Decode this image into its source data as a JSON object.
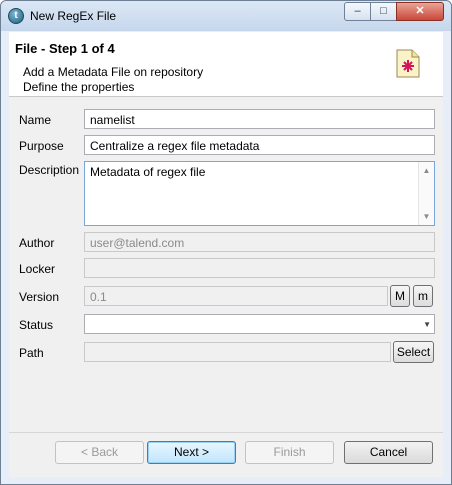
{
  "window": {
    "title": "New RegEx File",
    "app_icon_glyph": "t"
  },
  "window_controls": {
    "minimize": "–",
    "maximize": "□",
    "close": "✕"
  },
  "header": {
    "title": "File - Step 1 of 4",
    "description_line1": "Add a Metadata File on repository",
    "description_line2": "Define the properties",
    "icon": "regex-file-icon"
  },
  "form": {
    "name": {
      "label": "Name",
      "value": "namelist"
    },
    "purpose": {
      "label": "Purpose",
      "value": "Centralize a regex file metadata"
    },
    "description": {
      "label": "Description",
      "value": "Metadata of regex file"
    },
    "author": {
      "label": "Author",
      "value": "user@talend.com"
    },
    "locker": {
      "label": "Locker",
      "value": ""
    },
    "version": {
      "label": "Version",
      "value": "0.1",
      "major_button": "M",
      "minor_button": "m"
    },
    "status": {
      "label": "Status",
      "value": ""
    },
    "path": {
      "label": "Path",
      "value": "",
      "select_button": "Select"
    }
  },
  "buttons": {
    "back": "< Back",
    "next": "Next >",
    "finish": "Finish",
    "cancel": "Cancel"
  },
  "colors": {
    "titlebar": "#c6d7ec",
    "close": "#c9473a",
    "primary_border": "#3c7fb1"
  }
}
